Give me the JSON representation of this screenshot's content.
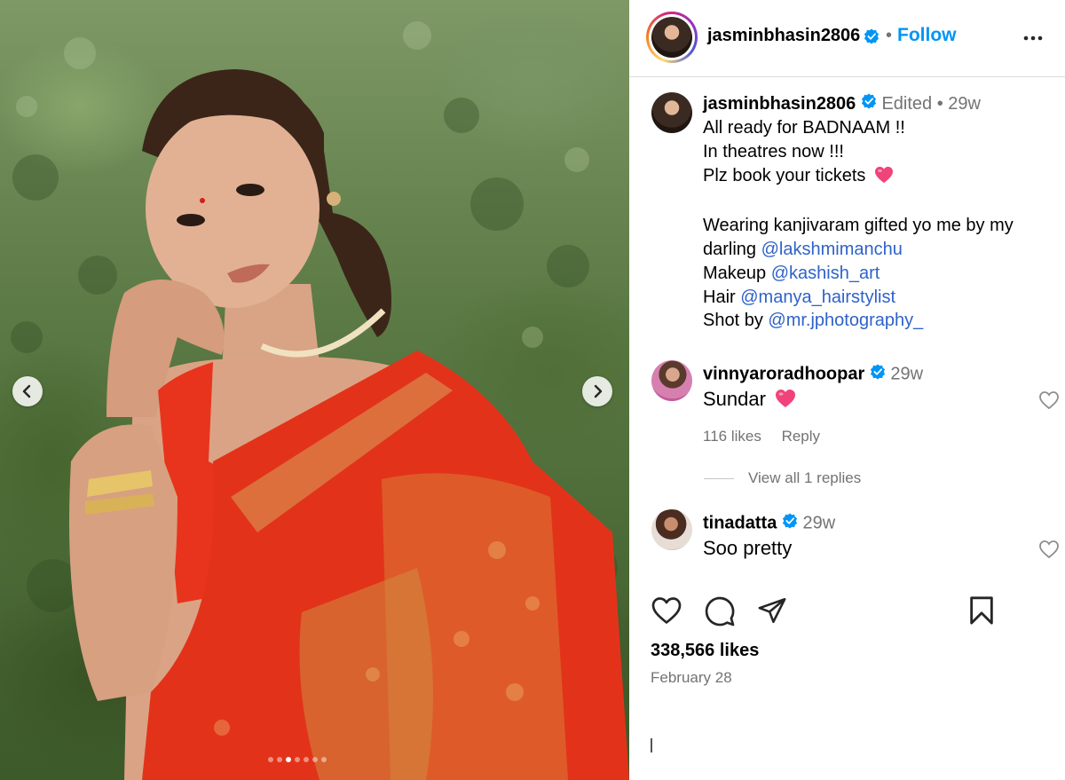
{
  "post": {
    "author": "jasminbhasin2806",
    "follow_label": "Follow",
    "separator": "•",
    "carousel": {
      "slide_count": 7,
      "active_index": 2
    }
  },
  "caption": {
    "username": "jasminbhasin2806",
    "edited": "Edited",
    "separator": "•",
    "time": "29w",
    "line1": "All ready for BADNAAM !!",
    "line2": "In theatres now !!!",
    "line3": "Plz book your tickets",
    "line4": "Wearing kanjivaram gifted yo me  by my",
    "line5_prefix": "darling",
    "mention1": "@lakshmimanchu",
    "line6_prefix": "Makeup",
    "mention2": "@kashish_art",
    "line7_prefix": "Hair",
    "mention3": "@manya_hairstylist",
    "line8_prefix": "Shot by",
    "mention4": "@mr.jphotography_"
  },
  "comments": [
    {
      "username": "vinnyaroradhoopar",
      "time": "29w",
      "text": "Sundar",
      "likes": "116 likes",
      "reply_label": "Reply",
      "view_replies": "View all 1 replies"
    },
    {
      "username": "tinadatta",
      "time": "29w",
      "text": "Soo pretty"
    }
  ],
  "footer": {
    "likes": "338,566 likes",
    "date": "February 28"
  },
  "colors": {
    "accent": "#0095f6",
    "mention": "#2f62c9",
    "muted": "#737373",
    "verified": "#0095f6",
    "heart_emoji": "#f0437a"
  },
  "icons": [
    "more-options-icon",
    "verified-badge-icon",
    "heart-icon",
    "comment-icon",
    "share-icon",
    "bookmark-icon",
    "chevron-left-icon",
    "chevron-right-icon"
  ]
}
